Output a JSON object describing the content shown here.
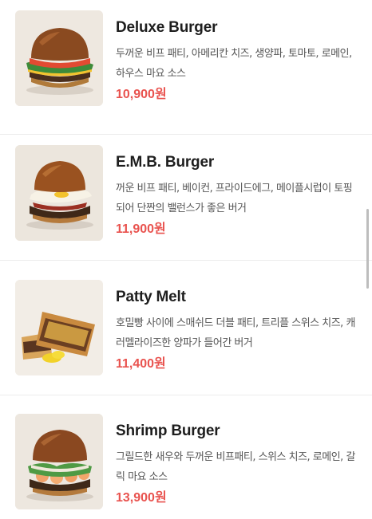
{
  "menu": {
    "items": [
      {
        "name": "Deluxe Burger",
        "description": "두꺼운 비프 패티, 아메리칸 치즈, 생양파, 토마토, 로메인, 하우스 마요 소스",
        "price": "10,900원",
        "image_icon": "deluxe-burger-photo"
      },
      {
        "name": "E.M.B. Burger",
        "description": "꺼운 비프 패티, 베이컨, 프라이드에그, 메이플시럽이 토핑되어 단짠의 밸런스가 좋은 버거",
        "price": "11,900원",
        "image_icon": "emb-burger-photo"
      },
      {
        "name": "Patty Melt",
        "description": "호밀빵 사이에 스매쉬드 더블 패티, 트리플 스위스 치즈, 캐러멜라이즈한 양파가 들어간 버거",
        "price": "11,400원",
        "image_icon": "patty-melt-photo"
      },
      {
        "name": "Shrimp Burger",
        "description": "그릴드한 새우와 두꺼운 비프패티, 스위스 치즈, 로메인, 갈릭 마요 소스",
        "price": "13,900원",
        "image_icon": "shrimp-burger-photo"
      }
    ]
  },
  "colors": {
    "price": "#e9534f",
    "title": "#1e1e1e",
    "description": "#555555",
    "divider": "#ececec"
  }
}
